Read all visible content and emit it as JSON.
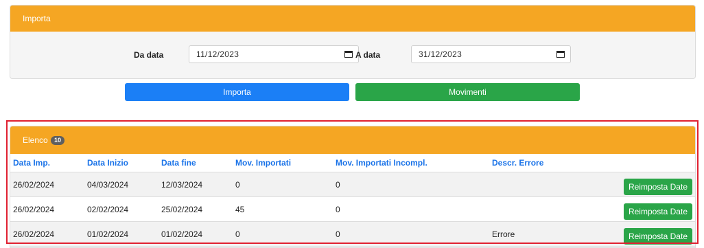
{
  "import_panel": {
    "title": "Importa",
    "from_label": "Da data",
    "from_value": "11/12/2023",
    "to_label": "A data",
    "to_value": "31/12/2023"
  },
  "actions": {
    "import_label": "Importa",
    "movements_label": "Movimenti"
  },
  "list_panel": {
    "title": "Elenco",
    "count": "10",
    "columns": [
      "Data Imp.",
      "Data Inizio",
      "Data fine",
      "Mov. Importati",
      "Mov. Importati Incompl.",
      "Descr. Errore",
      ""
    ],
    "rows": [
      {
        "imp": "26/02/2024",
        "start": "04/03/2024",
        "end": "12/03/2024",
        "mov": "0",
        "incomplete": "0",
        "error": "",
        "action": "Reimposta Date"
      },
      {
        "imp": "26/02/2024",
        "start": "02/02/2024",
        "end": "25/02/2024",
        "mov": "45",
        "incomplete": "0",
        "error": "",
        "action": "Reimposta Date"
      },
      {
        "imp": "26/02/2024",
        "start": "01/02/2024",
        "end": "01/02/2024",
        "mov": "0",
        "incomplete": "0",
        "error": "Errore",
        "action": "Reimposta Date"
      }
    ]
  },
  "colors": {
    "header_orange": "#f5a623",
    "primary_blue": "#1b7ff6",
    "success_green": "#2aa548",
    "link_blue": "#1a73e8",
    "highlight_red": "#e02030"
  }
}
